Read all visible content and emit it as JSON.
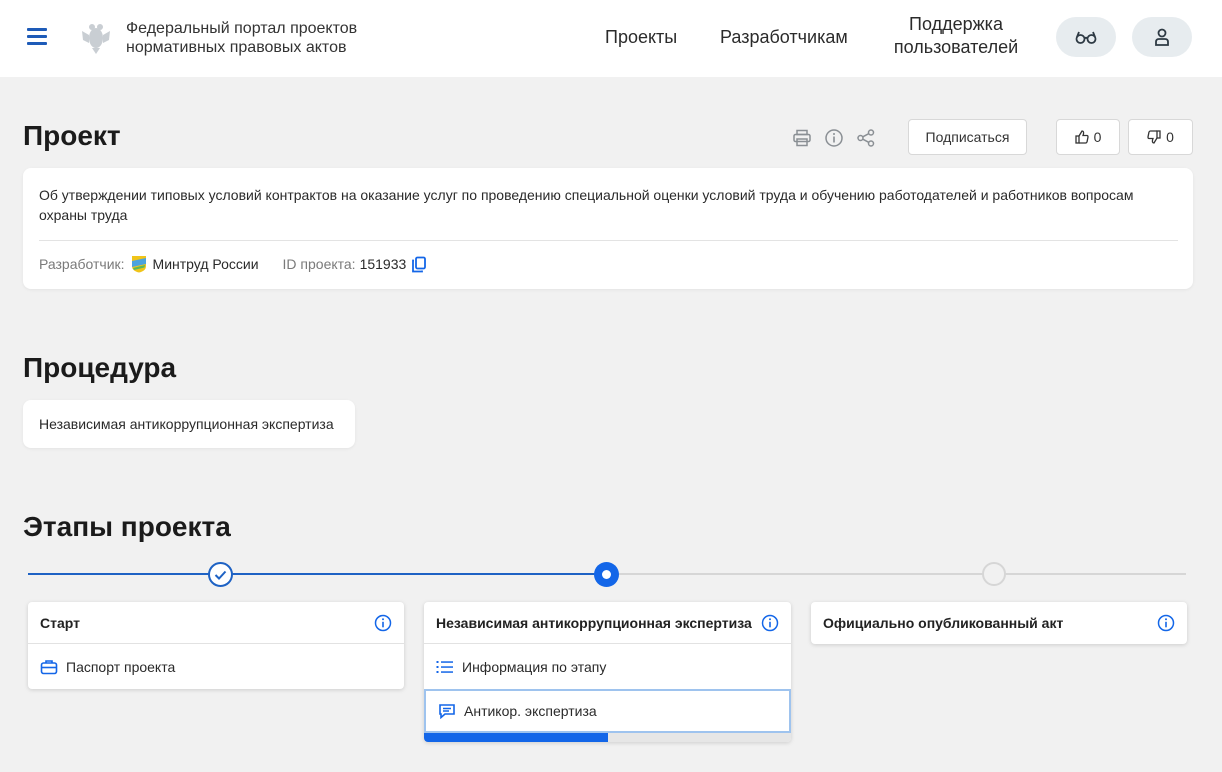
{
  "header": {
    "portal_title": "Федеральный портал проектов нормативных правовых актов",
    "nav": {
      "projects": "Проекты",
      "developers": "Разработчикам",
      "support": "Поддержка пользователей"
    },
    "icons": {
      "menu": "hamburger-icon",
      "emblem": "coat-of-arms-icon",
      "accessibility": "glasses-icon",
      "user": "user-icon"
    }
  },
  "project": {
    "heading": "Проект",
    "subscribe_label": "Подписаться",
    "likes": "0",
    "dislikes": "0",
    "description": "Об утверждении типовых условий контрактов на оказание услуг по проведению специальной оценки условий труда и обучению работодателей и работников вопросам охраны труда",
    "developer_label": "Разработчик:",
    "developer_name": "Минтруд России",
    "id_label": "ID проекта:",
    "id_value": "151933",
    "tool_icons": [
      "print-icon",
      "info-icon",
      "share-icon",
      "copy-icon"
    ]
  },
  "procedure": {
    "heading": "Процедура",
    "value": "Независимая антикоррупционная экспертиза"
  },
  "stages": {
    "heading": "Этапы проекта",
    "items": [
      {
        "title": "Старт",
        "status": "done",
        "links": [
          {
            "label": "Паспорт проекта",
            "icon": "briefcase-icon"
          }
        ]
      },
      {
        "title": "Независимая антикоррупционная экспертиза",
        "status": "current",
        "links": [
          {
            "label": "Информация по этапу",
            "icon": "list-icon"
          },
          {
            "label": "Антикор. экспертиза",
            "icon": "comment-icon"
          }
        ],
        "progress": 0.5
      },
      {
        "title": "Официально опубликованный акт",
        "status": "future",
        "links": []
      }
    ]
  },
  "colors": {
    "accent": "#1366e8",
    "line_done": "#1e62c4",
    "background": "#f1f1f1"
  }
}
